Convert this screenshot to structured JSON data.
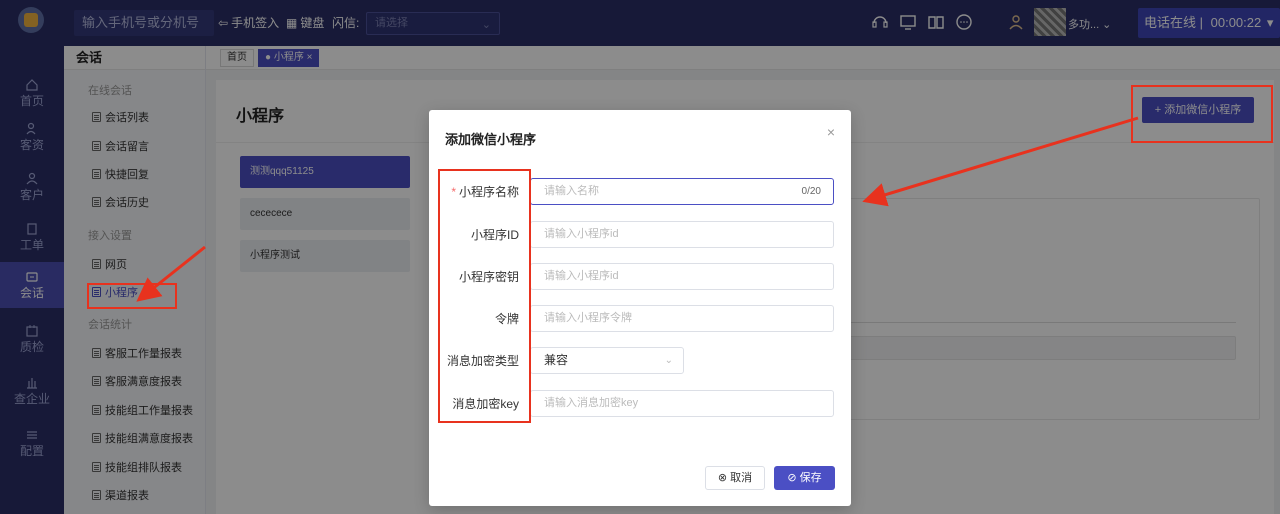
{
  "nav_rail": {
    "items": [
      {
        "label": "首页",
        "icon": "home-icon"
      },
      {
        "label": "客资",
        "icon": "leads-icon"
      },
      {
        "label": "客户",
        "icon": "customer-icon"
      },
      {
        "label": "工单",
        "icon": "ticket-icon"
      },
      {
        "label": "会话",
        "icon": "chat-icon",
        "active": true
      },
      {
        "label": "质检",
        "icon": "quality-icon"
      },
      {
        "label": "查企业",
        "icon": "enterprise-icon"
      },
      {
        "label": "配置",
        "icon": "settings-icon"
      }
    ]
  },
  "topbar": {
    "dialer_placeholder": "输入手机号或分机号",
    "sign_in_label": "手机签入",
    "keyboard_label": "键盘",
    "flash_label": "闪信:",
    "flash_select_placeholder": "请选择",
    "more_label": "多功...",
    "status_label": "电话在线 |",
    "timer": "00:00:22"
  },
  "submenu": {
    "title": "会话",
    "groups": [
      {
        "label": "在线会话",
        "items": [
          "会话列表",
          "会话留言",
          "快捷回复",
          "会话历史"
        ]
      },
      {
        "label": "接入设置",
        "items": [
          "网页",
          "小程序"
        ]
      },
      {
        "label": "会话统计",
        "items": [
          "客服工作量报表",
          "客服满意度报表",
          "技能组工作量报表",
          "技能组满意度报表",
          "技能组排队报表",
          "渠道报表"
        ]
      }
    ],
    "active_item": "小程序"
  },
  "tabs": [
    {
      "label": "首页",
      "active": false
    },
    {
      "label": "● 小程序 ×",
      "active": true
    }
  ],
  "main": {
    "title": "小程序",
    "add_button": "+ 添加微信小程序",
    "app_list": [
      "测测qqq51125",
      "cececece",
      "小程序测试"
    ]
  },
  "modal": {
    "title": "添加微信小程序",
    "close": "×",
    "fields": [
      {
        "label": "小程序名称",
        "required": true,
        "placeholder": "请输入名称",
        "counter": "0/20",
        "type": "input"
      },
      {
        "label": "小程序ID",
        "required": false,
        "placeholder": "请输入小程序id",
        "type": "input"
      },
      {
        "label": "小程序密钥",
        "required": false,
        "placeholder": "请输入小程序id",
        "type": "input"
      },
      {
        "label": "令牌",
        "required": false,
        "placeholder": "请输入小程序令牌",
        "type": "input"
      },
      {
        "label": "消息加密类型",
        "required": false,
        "value": "兼容",
        "type": "select"
      },
      {
        "label": "消息加密key",
        "required": false,
        "placeholder": "请输入消息加密key",
        "type": "input"
      }
    ],
    "cancel_label": "⊗ 取消",
    "save_label": "⊘ 保存"
  },
  "colors": {
    "primary": "#4b4fc4",
    "nav_bg": "#2b2f66",
    "annotation": "#e8321e"
  }
}
